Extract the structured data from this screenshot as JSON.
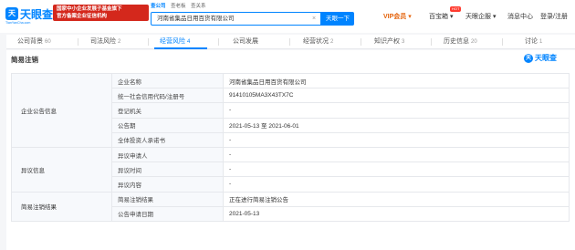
{
  "header": {
    "logo_mark": "天",
    "logo_text": "天眼查",
    "logo_sub": "TianYanCha.com",
    "promo_lines": [
      "国家中小企业发展子基金旗下",
      "官方备案企业征信机构"
    ],
    "search_tabs": [
      "查公司",
      "查老板",
      "查关系"
    ],
    "search_value": "河南省集品日用百货有限公司",
    "search_clear": "×",
    "search_button": "天眼一下",
    "nav": {
      "vip": "VIP会员 ▾",
      "hot": "HOT",
      "baibaoxiang": "百宝箱 ▾",
      "app": "天眼企服 ▾",
      "messages": "消息中心",
      "login": "登录/注册"
    }
  },
  "tabs": [
    {
      "label": "公司背景",
      "count": "60"
    },
    {
      "label": "司法风险",
      "count": "2"
    },
    {
      "label": "经营风险",
      "count": "4"
    },
    {
      "label": "公司发展",
      "count": ""
    },
    {
      "label": "经营状况",
      "count": "2"
    },
    {
      "label": "知识产权",
      "count": "3"
    },
    {
      "label": "历史信息",
      "count": "20"
    },
    {
      "label": "讨论",
      "count": "1"
    }
  ],
  "section": {
    "title": "简易注销",
    "brand_mark": "天",
    "brand_text": "天眼查"
  },
  "table": {
    "groups": [
      {
        "name": "企业公告信息",
        "rows": [
          {
            "label": "企业名称",
            "value": "河南省集品日用百货有限公司"
          },
          {
            "label": "统一社会信用代码/注册号",
            "value": "91410105MA3X43TX7C"
          },
          {
            "label": "登记机关",
            "value": "-"
          },
          {
            "label": "公告期",
            "value": "2021-05-13 至 2021-06-01"
          },
          {
            "label": "全体投资人承诺书",
            "value": "-"
          }
        ]
      },
      {
        "name": "异议信息",
        "rows": [
          {
            "label": "异议申请人",
            "value": "-"
          },
          {
            "label": "异议时间",
            "value": "-"
          },
          {
            "label": "异议内容",
            "value": "-"
          }
        ]
      },
      {
        "name": "简易注销结果",
        "rows": [
          {
            "label": "简易注销结果",
            "value": "正在进行简易注销公告"
          },
          {
            "label": "公告申请日期",
            "value": "2021-05-13"
          }
        ]
      }
    ]
  }
}
